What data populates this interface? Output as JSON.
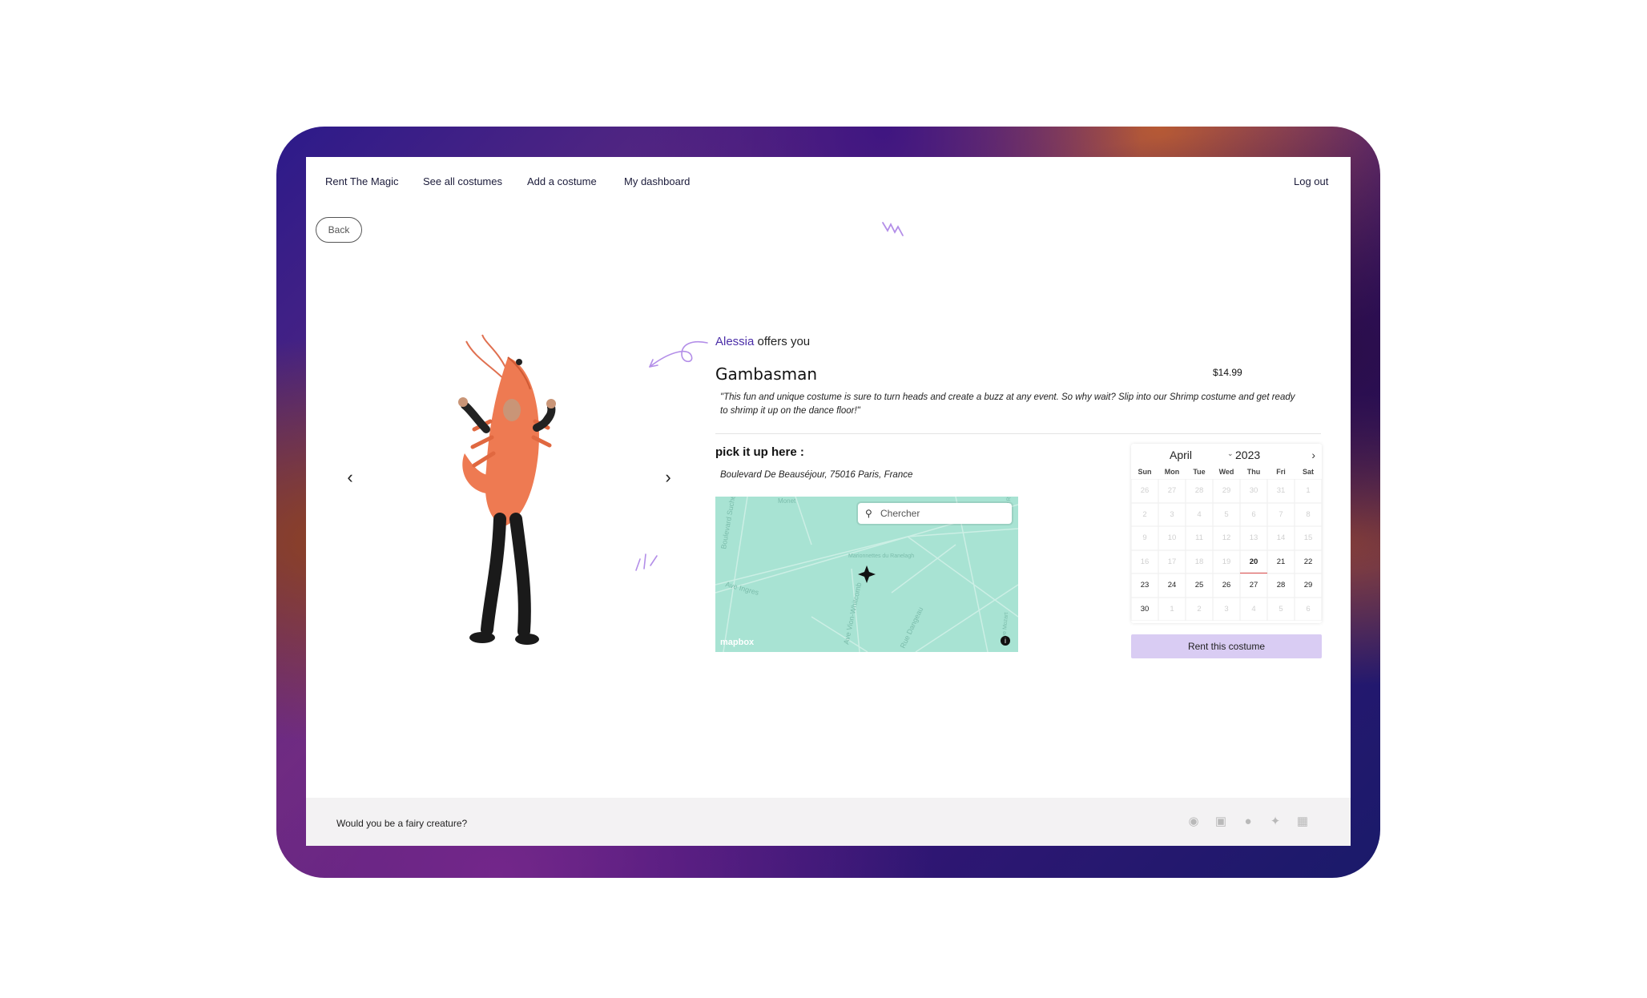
{
  "nav": {
    "brand": "Rent The Magic",
    "all_costumes": "See all costumes",
    "add_costume": "Add a costume",
    "dashboard": "My dashboard",
    "logout": "Log out"
  },
  "back_label": "Back",
  "carousel": {
    "prev_icon": "‹",
    "next_icon": "›"
  },
  "listing": {
    "owner": "Alessia",
    "offer_text": " offers you",
    "title": "Gambasman",
    "price": "$14.99",
    "description": "\"This fun and unique costume is sure to turn heads and create a buzz at any event. So why wait? Slip into our Shrimp costume and get ready to shrimp it up on the dance floor!\"",
    "pickup_heading": "pick it up here :",
    "address": "Boulevard De Beauséjour, 75016 Paris, France"
  },
  "map": {
    "search_placeholder": "Chercher",
    "logo": "mapbox",
    "info_icon": "i",
    "streets": [
      "Boulevard Suchet",
      "Ave Ingres",
      "Ave Vion-Whitcomb",
      "Rue Dangeau",
      "Marionnettes du Ranelagh",
      "Ave Mozart",
      "Rue du Ranelagh",
      "Monet"
    ]
  },
  "calendar": {
    "month": "April",
    "year": "2023",
    "dows": [
      "Sun",
      "Mon",
      "Tue",
      "Wed",
      "Thu",
      "Fri",
      "Sat"
    ],
    "days": [
      {
        "n": "26",
        "s": "muted"
      },
      {
        "n": "27",
        "s": "muted"
      },
      {
        "n": "28",
        "s": "muted"
      },
      {
        "n": "29",
        "s": "muted"
      },
      {
        "n": "30",
        "s": "muted"
      },
      {
        "n": "31",
        "s": "muted"
      },
      {
        "n": "1",
        "s": "muted"
      },
      {
        "n": "2",
        "s": "muted"
      },
      {
        "n": "3",
        "s": "muted"
      },
      {
        "n": "4",
        "s": "muted"
      },
      {
        "n": "5",
        "s": "muted"
      },
      {
        "n": "6",
        "s": "muted"
      },
      {
        "n": "7",
        "s": "muted"
      },
      {
        "n": "8",
        "s": "muted"
      },
      {
        "n": "9",
        "s": "muted"
      },
      {
        "n": "10",
        "s": "muted"
      },
      {
        "n": "11",
        "s": "muted"
      },
      {
        "n": "12",
        "s": "muted"
      },
      {
        "n": "13",
        "s": "muted"
      },
      {
        "n": "14",
        "s": "muted"
      },
      {
        "n": "15",
        "s": "muted"
      },
      {
        "n": "16",
        "s": "muted"
      },
      {
        "n": "17",
        "s": "muted"
      },
      {
        "n": "18",
        "s": "muted"
      },
      {
        "n": "19",
        "s": "muted"
      },
      {
        "n": "20",
        "s": "today"
      },
      {
        "n": "21",
        "s": "active"
      },
      {
        "n": "22",
        "s": "active"
      },
      {
        "n": "23",
        "s": "active"
      },
      {
        "n": "24",
        "s": "active"
      },
      {
        "n": "25",
        "s": "active"
      },
      {
        "n": "26",
        "s": "active"
      },
      {
        "n": "27",
        "s": "active"
      },
      {
        "n": "28",
        "s": "active"
      },
      {
        "n": "29",
        "s": "active"
      },
      {
        "n": "30",
        "s": "active"
      },
      {
        "n": "1",
        "s": "muted"
      },
      {
        "n": "2",
        "s": "muted"
      },
      {
        "n": "3",
        "s": "muted"
      },
      {
        "n": "4",
        "s": "muted"
      },
      {
        "n": "5",
        "s": "muted"
      },
      {
        "n": "6",
        "s": "muted"
      }
    ]
  },
  "rent_button": "Rent this costume",
  "footer": {
    "tagline": "Would you be a fairy creature?",
    "socials": [
      "github-icon",
      "instagram-icon",
      "facebook-icon",
      "twitter-icon",
      "linkedin-icon"
    ]
  },
  "colors": {
    "accent": "#d9ccf3",
    "owner": "#4b2ea8",
    "doodle": "#b38ee8",
    "map": "#a8e3d3",
    "shrimp": "#ee7a52"
  }
}
